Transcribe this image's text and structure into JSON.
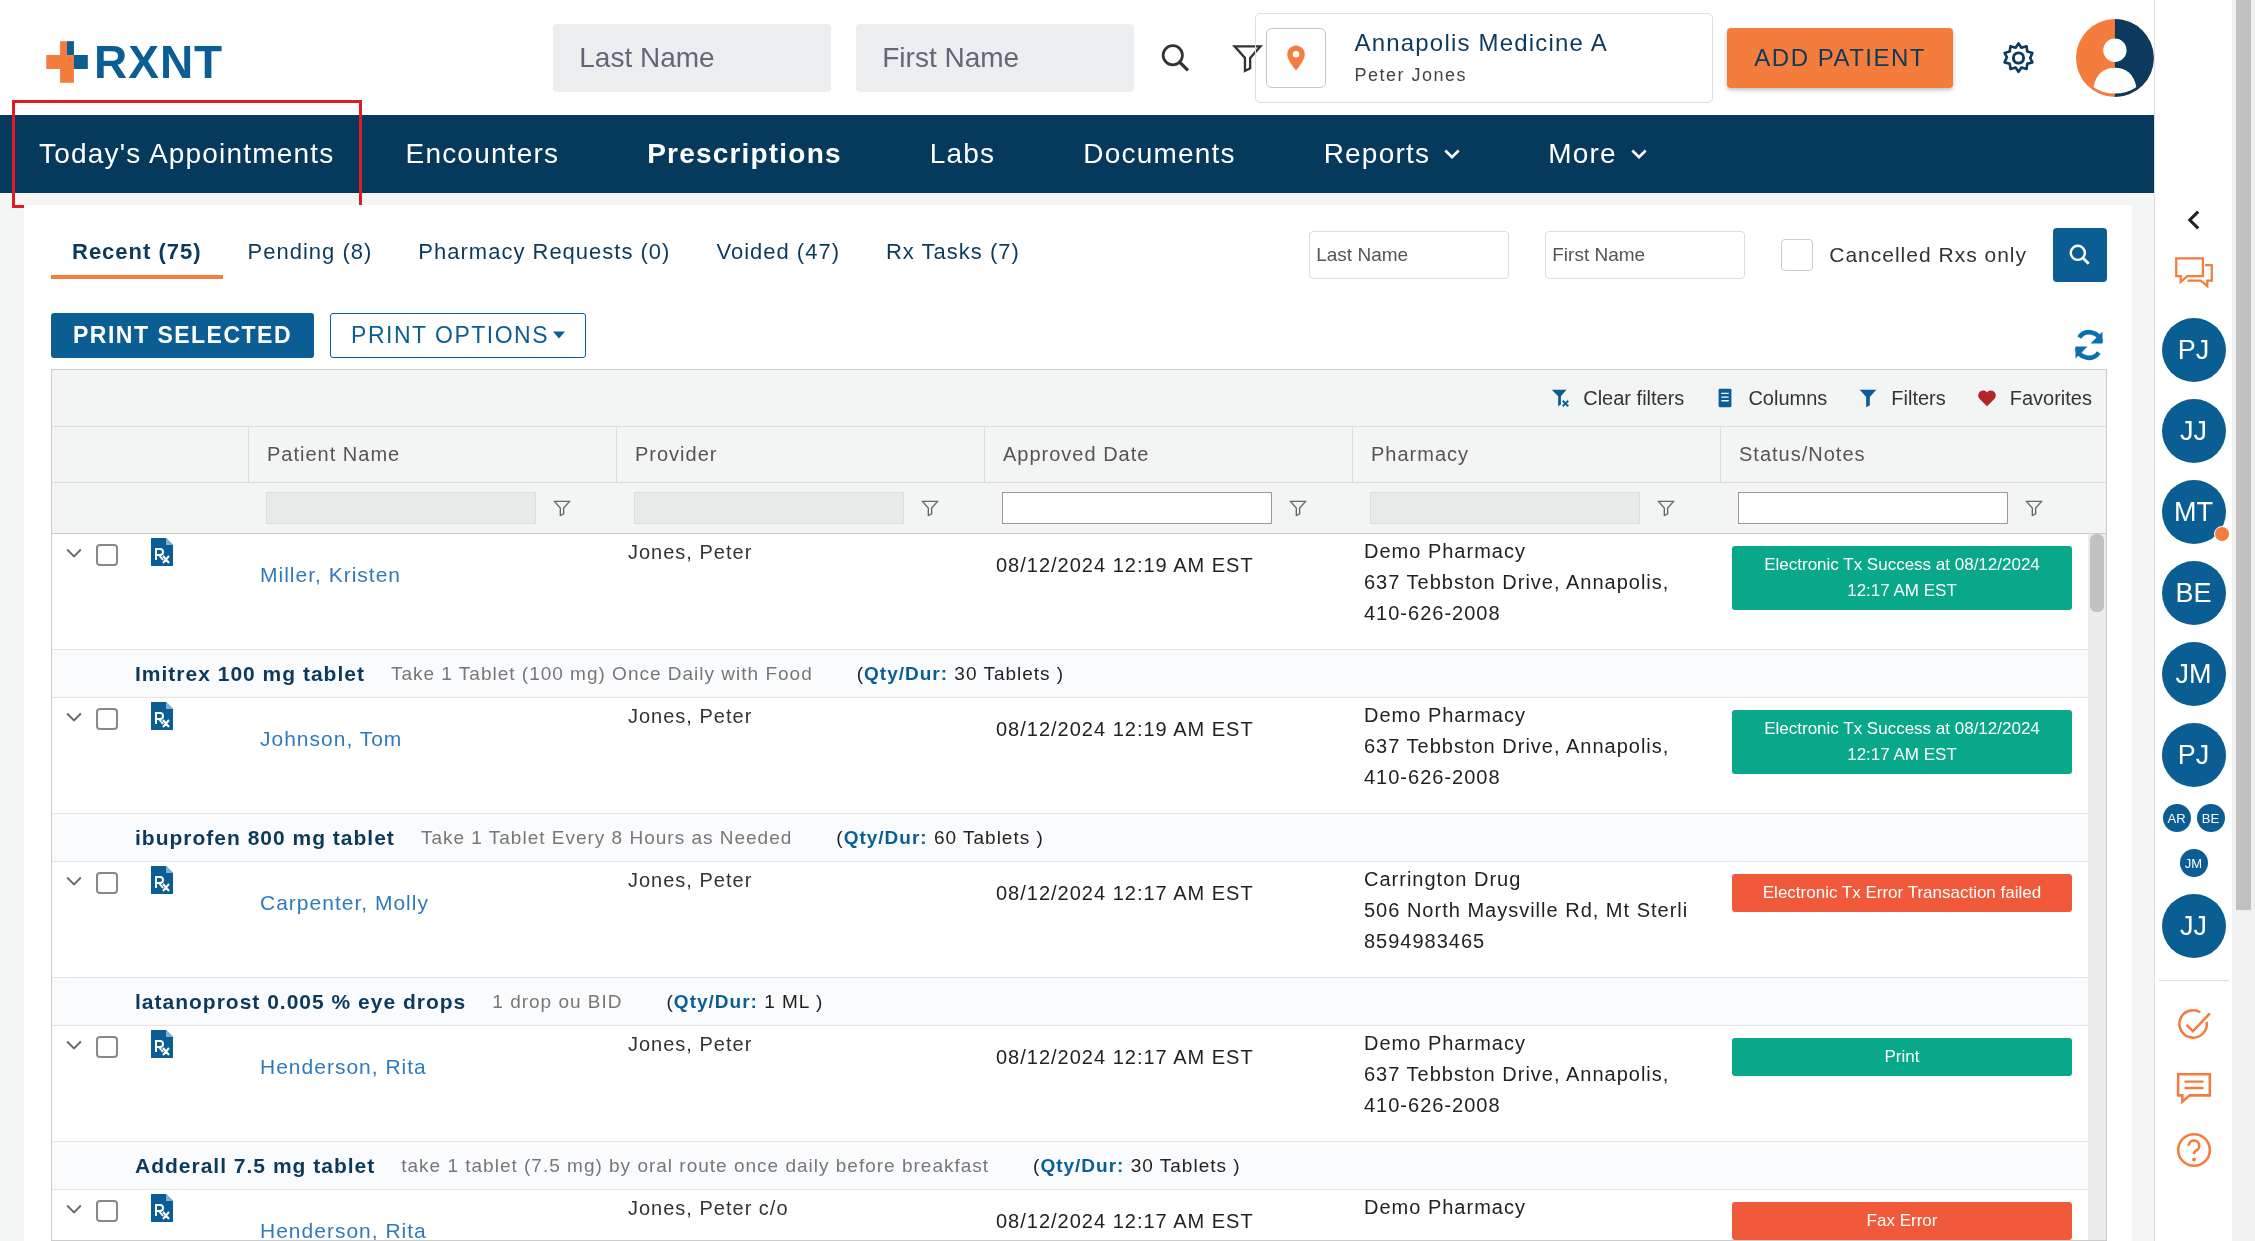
{
  "header": {
    "logo": "RXNT",
    "search": [
      {
        "placeholder": "Last Name"
      },
      {
        "placeholder": "First Name"
      }
    ],
    "location": {
      "name": "Annapolis Medicine A",
      "user": "Peter Jones"
    },
    "add_button": "ADD PATIENT"
  },
  "nav": [
    {
      "label": "Today's Appointments",
      "selected": false,
      "dropdown": false,
      "highlighted": true
    },
    {
      "label": "Encounters",
      "selected": false,
      "dropdown": false,
      "highlighted": false
    },
    {
      "label": "Prescriptions",
      "selected": true,
      "dropdown": false,
      "highlighted": false
    },
    {
      "label": "Labs",
      "selected": false,
      "dropdown": false,
      "highlighted": false
    },
    {
      "label": "Documents",
      "selected": false,
      "dropdown": false,
      "highlighted": false
    },
    {
      "label": "Reports",
      "selected": false,
      "dropdown": true,
      "highlighted": false
    },
    {
      "label": "More",
      "selected": false,
      "dropdown": true,
      "highlighted": false
    }
  ],
  "tabs": [
    {
      "label": "Recent (75)",
      "selected": true
    },
    {
      "label": "Pending (8)",
      "selected": false
    },
    {
      "label": "Pharmacy Requests (0)",
      "selected": false
    },
    {
      "label": "Voided (47)",
      "selected": false
    },
    {
      "label": "Rx Tasks (7)",
      "selected": false
    }
  ],
  "filters": {
    "fields": [
      {
        "placeholder": "Last Name"
      },
      {
        "placeholder": "First Name"
      }
    ],
    "cancelled": {
      "label": "Cancelled Rxs only",
      "checked": false
    }
  },
  "buttons": {
    "print_selected": "PRINT SELECTED",
    "print_options": "PRINT OPTIONS"
  },
  "toolbar": [
    {
      "kind": "clear",
      "label": "Clear filters"
    },
    {
      "kind": "columns",
      "label": "Columns"
    },
    {
      "kind": "filters",
      "label": "Filters"
    },
    {
      "kind": "favorites",
      "label": "Favorites"
    }
  ],
  "table": {
    "columns": [
      {
        "label": "Patient Name",
        "filter_disabled": true
      },
      {
        "label": "Provider",
        "filter_disabled": true
      },
      {
        "label": "Approved Date",
        "filter_disabled": false
      },
      {
        "label": "Pharmacy",
        "filter_disabled": true
      },
      {
        "label": "Status/Notes",
        "filter_disabled": false
      }
    ],
    "rows": [
      {
        "checked": false,
        "patient": "Miller, Kristen",
        "provider": "Jones, Peter",
        "date": "08/12/2024 12:19 AM EST",
        "pharmacy": [
          "Demo Pharmacy",
          "637 Tebbston Drive, Annapolis,",
          "410-626-2008"
        ],
        "status": {
          "kind": "success",
          "text": "Electronic Tx Success at 08/12/2024 12:17 AM EST"
        },
        "drug": {
          "name": "Imitrex 100 mg tablet",
          "sig": "Take 1 Tablet (100 mg) Once Daily with Food",
          "qty": "(**Qty/Dur:** 30 Tablets )"
        }
      },
      {
        "checked": false,
        "patient": "Johnson, Tom",
        "provider": "Jones, Peter",
        "date": "08/12/2024 12:19 AM EST",
        "pharmacy": [
          "Demo Pharmacy",
          "637 Tebbston Drive, Annapolis,",
          "410-626-2008"
        ],
        "status": {
          "kind": "success",
          "text": "Electronic Tx Success at 08/12/2024 12:17 AM EST"
        },
        "drug": {
          "name": "ibuprofen 800 mg tablet",
          "sig": "Take 1 Tablet Every 8 Hours as Needed",
          "qty": "(**Qty/Dur:** 60 Tablets )"
        }
      },
      {
        "checked": false,
        "patient": "Carpenter, Molly",
        "provider": "Jones, Peter",
        "date": "08/12/2024 12:17 AM EST",
        "pharmacy": [
          "Carrington Drug",
          "506 North Maysville Rd, Mt Sterli",
          "8594983465"
        ],
        "status": {
          "kind": "error",
          "text": "Electronic Tx Error Transaction failed"
        },
        "drug": {
          "name": "latanoprost 0.005 % eye drops",
          "sig": "1 drop ou BID",
          "qty": "(**Qty/Dur:** 1 ML )"
        }
      },
      {
        "checked": false,
        "patient": "Henderson, Rita",
        "provider": "Jones, Peter",
        "date": "08/12/2024 12:17 AM EST",
        "pharmacy": [
          "Demo Pharmacy",
          "637 Tebbston Drive, Annapolis,",
          "410-626-2008"
        ],
        "status": {
          "kind": "success",
          "text": "Print"
        },
        "drug": {
          "name": "Adderall 7.5 mg tablet",
          "sig": "take 1 tablet (7.5 mg) by oral route once daily before breakfast",
          "qty": "(**Qty/Dur:** 30 Tablets )"
        }
      },
      {
        "checked": false,
        "patient": "Henderson, Rita",
        "provider": "Jones, Peter c/o",
        "date": "08/12/2024 12:17 AM EST",
        "pharmacy": [
          "Demo Pharmacy"
        ],
        "status": {
          "kind": "error",
          "text": "Fax Error"
        }
      }
    ]
  },
  "sidebar": {
    "users": [
      {
        "initials": "PJ",
        "kind": "large",
        "notify": false
      },
      {
        "initials": "JJ",
        "kind": "large",
        "notify": false
      },
      {
        "initials": "MT",
        "kind": "large",
        "notify": true
      },
      {
        "initials": "BE",
        "kind": "large",
        "notify": false
      },
      {
        "initials": "JM",
        "kind": "large",
        "notify": false
      },
      {
        "initials": "PJ",
        "kind": "large",
        "notify": false
      },
      {
        "initials": "AR",
        "kind": "small",
        "notify": false
      },
      {
        "initials": "BE",
        "kind": "small",
        "notify": false
      },
      {
        "initials": "JM",
        "kind": "small",
        "notify": false
      },
      {
        "initials": "JJ",
        "kind": "large",
        "notify": false
      }
    ]
  }
}
